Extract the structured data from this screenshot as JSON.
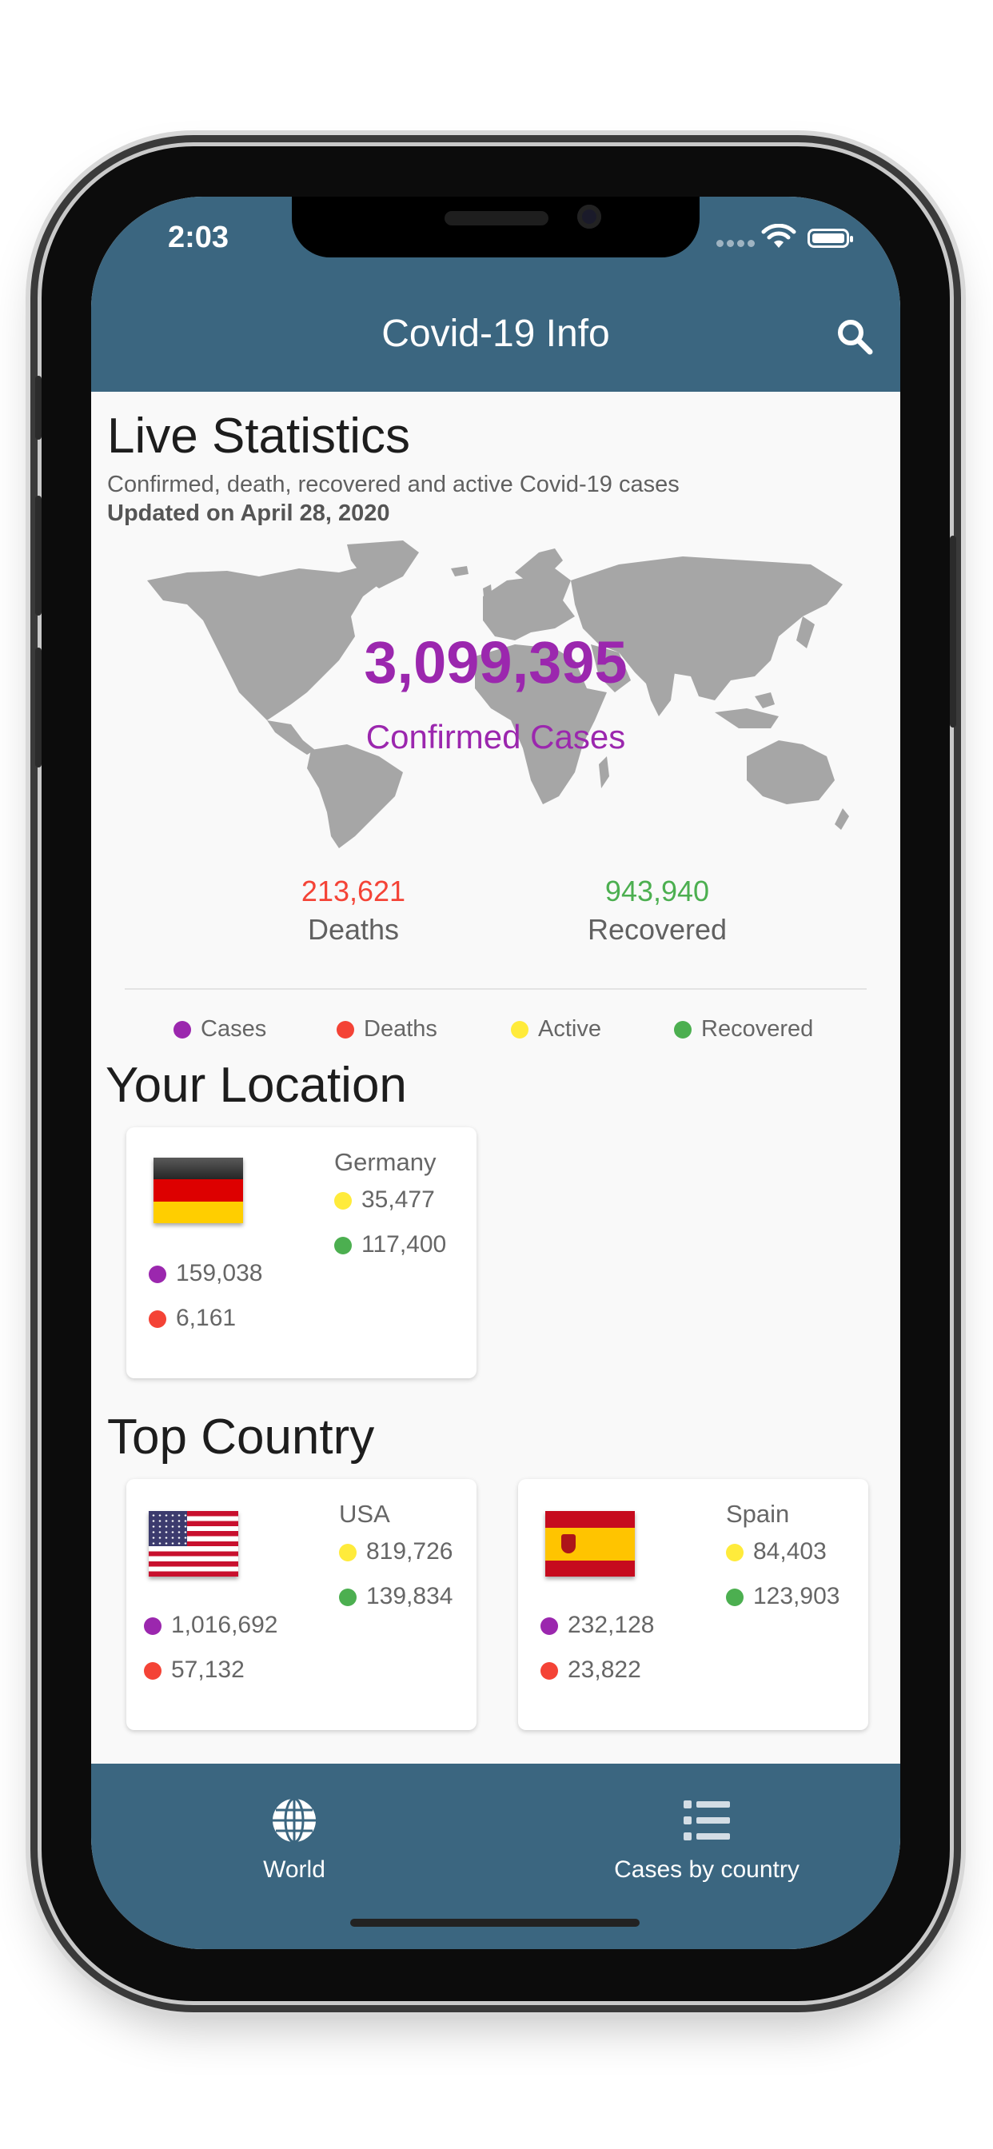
{
  "status_bar": {
    "time": "2:03"
  },
  "app_bar": {
    "title": "Covid-19 Info",
    "search_icon": "search-icon"
  },
  "live_stats": {
    "heading": "Live Statistics",
    "subtitle": "Confirmed, death, recovered and active Covid-19 cases",
    "updated": "Updated on April 28, 2020",
    "confirmed_value": "3,099,395",
    "confirmed_label": "Confirmed Cases",
    "deaths_value": "213,621",
    "deaths_label": "Deaths",
    "recovered_value": "943,940",
    "recovered_label": "Recovered"
  },
  "legend": [
    {
      "label": "Cases",
      "color": "#9b27ae"
    },
    {
      "label": "Deaths",
      "color": "#f44336"
    },
    {
      "label": "Active",
      "color": "#ffeb3b"
    },
    {
      "label": "Recovered",
      "color": "#4caf50"
    }
  ],
  "your_location": {
    "heading": "Your Location",
    "country": "Germany",
    "flag_icon": "germany-flag-icon",
    "active": "35,477",
    "recovered": "117,400",
    "cases": "159,038",
    "deaths": "6,161"
  },
  "top_country": {
    "heading": "Top Country",
    "countries": [
      {
        "country": "USA",
        "flag_icon": "usa-flag-icon",
        "active": "819,726",
        "recovered": "139,834",
        "cases": "1,016,692",
        "deaths": "57,132"
      },
      {
        "country": "Spain",
        "flag_icon": "spain-flag-icon",
        "active": "84,403",
        "recovered": "123,903",
        "cases": "232,128",
        "deaths": "23,822"
      }
    ]
  },
  "bottom_nav": [
    {
      "label": "World",
      "icon": "globe-icon"
    },
    {
      "label": "Cases by country",
      "icon": "list-icon"
    }
  ],
  "colors": {
    "appbar": "#3b6680",
    "cases": "#9b27ae",
    "deaths": "#f44336",
    "active": "#ffeb3b",
    "recovered": "#4caf50"
  }
}
